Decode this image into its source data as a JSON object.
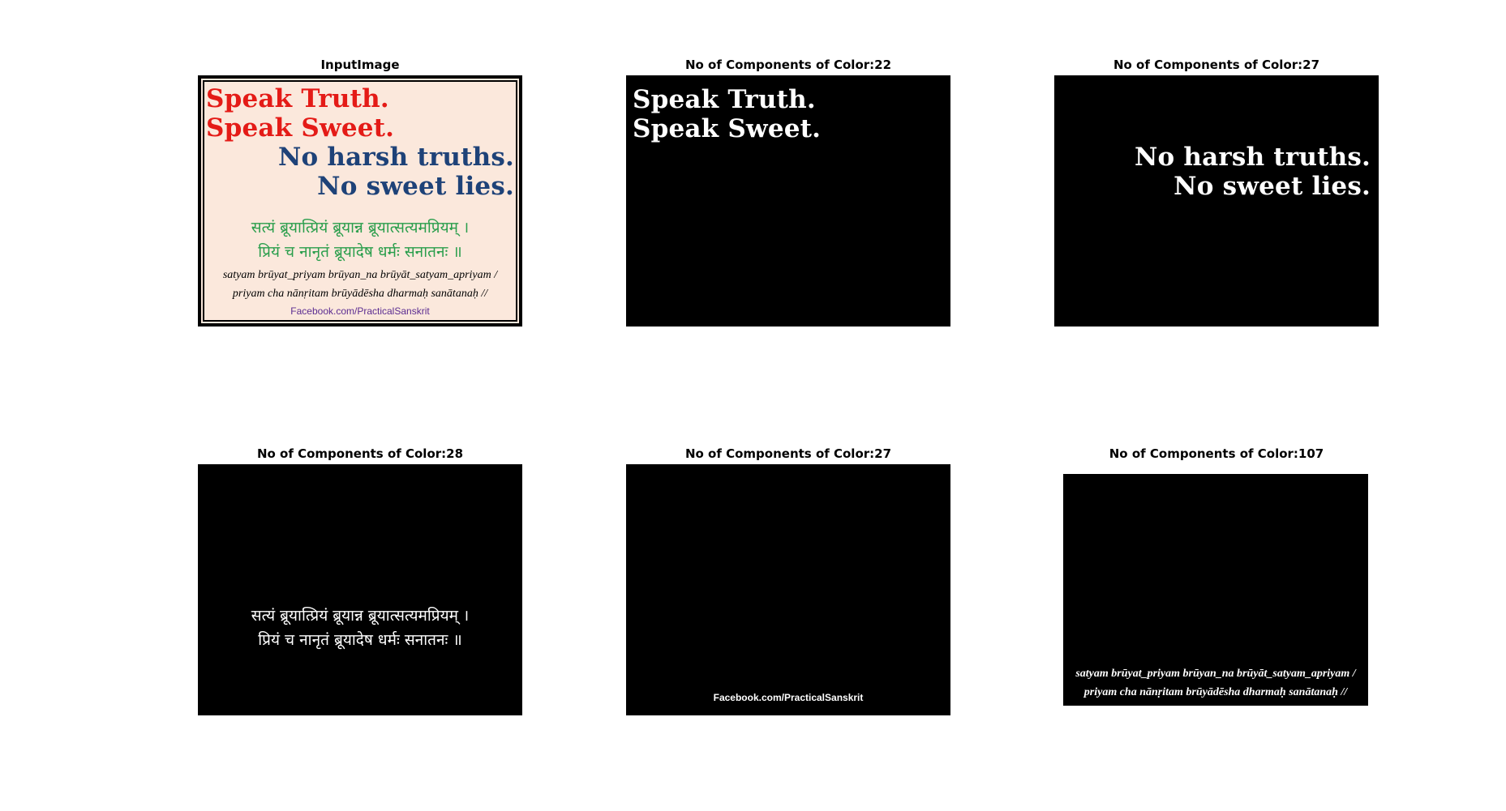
{
  "figure": {
    "panels": [
      {
        "title": "InputImage"
      },
      {
        "title": "No of Components of Color:22"
      },
      {
        "title": "No of Components of Color:27"
      },
      {
        "title": "No of Components of Color:28"
      },
      {
        "title": "No of Components of Color:27"
      },
      {
        "title": "No of Components of Color:107"
      }
    ]
  },
  "poster": {
    "line1": "Speak Truth.",
    "line2": "Speak Sweet.",
    "line3": "No harsh truths.",
    "line4": "No sweet lies.",
    "sanskrit1": "सत्यं ब्रूयात्प्रियं ब्रूयान्न ब्रूयात्सत्यमप्रियम् ।",
    "sanskrit2": "प्रियं च नानृतं ब्रूयादेष धर्मः सनातनः ॥",
    "translit1": "satyam brūyat_priyam brūyan_na brūyāt_satyam_apriyam /",
    "translit2": "priyam cha nānṛitam brūyādēsha dharmaḥ sanātanaḥ //",
    "credit": "Facebook.com/PracticalSanskrit"
  },
  "colors": {
    "red_text": "#e41b17",
    "blue_text": "#1e4278",
    "green_text": "#2a9e4c",
    "purple_text": "#5b2c91",
    "background": "#fbe8dc"
  }
}
